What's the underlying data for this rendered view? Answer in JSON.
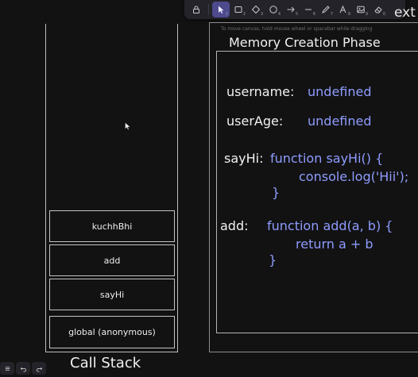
{
  "toolbar": {
    "tools": [
      {
        "name": "lock-icon",
        "key": ""
      },
      {
        "name": "selection-arrow-icon",
        "key": "1"
      },
      {
        "name": "rectangle-icon",
        "key": "2"
      },
      {
        "name": "diamond-icon",
        "key": "3"
      },
      {
        "name": "ellipse-icon",
        "key": "4"
      },
      {
        "name": "arrow-icon",
        "key": "5"
      },
      {
        "name": "line-icon",
        "key": "6"
      },
      {
        "name": "pencil-icon",
        "key": "7"
      },
      {
        "name": "text-icon",
        "key": "8"
      },
      {
        "name": "image-icon",
        "key": "9"
      },
      {
        "name": "eraser-icon",
        "key": "0"
      }
    ],
    "active_tool": "selection-arrow-icon"
  },
  "hint": "To move canvas, hold mouse wheel or spacebar while dragging",
  "clipped_text": "ext",
  "call_stack": {
    "title": "Call Stack",
    "items": [
      {
        "label": "kuchhBhi"
      },
      {
        "label": "add"
      },
      {
        "label": "sayHi"
      },
      {
        "label": "global (anonymous)"
      }
    ]
  },
  "memory": {
    "title": "Memory Creation Phase",
    "entries": [
      {
        "key": "username:",
        "value": [
          "undefined"
        ]
      },
      {
        "key": "userAge:",
        "value": [
          "undefined"
        ]
      },
      {
        "key": "sayHi:",
        "value": [
          "function sayHi() {",
          "console.log('Hii');",
          "}"
        ]
      },
      {
        "key": "add:",
        "value": [
          "function add(a, b) {",
          "return a + b",
          "}"
        ]
      }
    ]
  },
  "colors": {
    "background": "#121212",
    "value_text": "#8f9cff",
    "active_tool": "#4d4a8e",
    "toolbar": "#232329"
  },
  "controls": [
    {
      "name": "menu-icon"
    },
    {
      "name": "undo-icon"
    },
    {
      "name": "redo-icon"
    }
  ]
}
